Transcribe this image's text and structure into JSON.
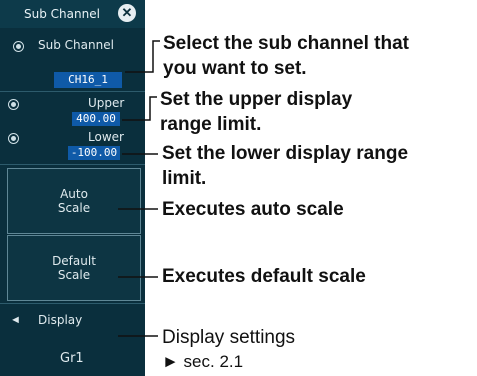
{
  "panel": {
    "title": "Sub Channel",
    "sub_channel_label": "Sub Channel",
    "sub_channel_value": "CH16_1",
    "upper_label": "Upper",
    "upper_value": "400.00",
    "lower_label": "Lower",
    "lower_value": "-100.00",
    "auto_scale_line1": "Auto",
    "auto_scale_line2": "Scale",
    "default_scale_line1": "Default",
    "default_scale_line2": "Scale",
    "display_label": "Display",
    "display_value": "Gr1"
  },
  "callouts": {
    "sub_channel_1": "Select the sub channel that",
    "sub_channel_2": "you want to set.",
    "upper_1": "Set the upper display",
    "upper_2": "range limit.",
    "lower_1": "Set the lower display range",
    "lower_2": "limit.",
    "auto_scale": "Executes auto scale",
    "default_scale": "Executes default scale",
    "display_1": "Display settings",
    "display_2": "► sec. 2.1"
  }
}
